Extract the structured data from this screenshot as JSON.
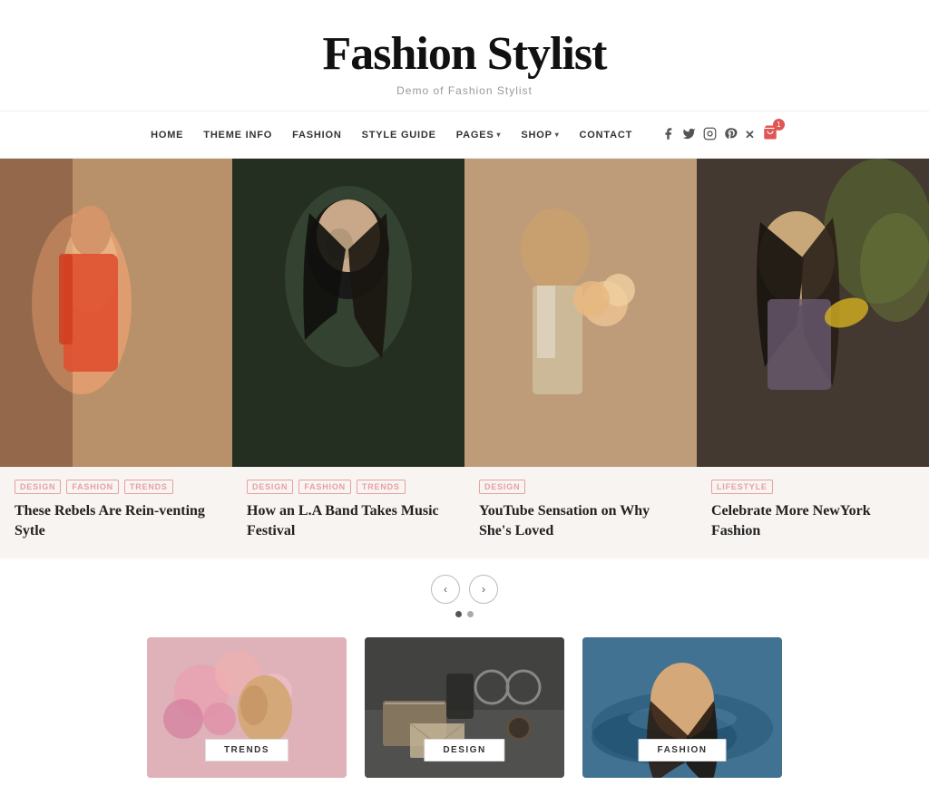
{
  "site": {
    "title": "Fashion Stylist",
    "subtitle": "Demo of Fashion Stylist"
  },
  "nav": {
    "links": [
      {
        "label": "HOME",
        "has_dropdown": false
      },
      {
        "label": "THEME INFO",
        "has_dropdown": false
      },
      {
        "label": "FASHION",
        "has_dropdown": false
      },
      {
        "label": "STYLE GUIDE",
        "has_dropdown": false
      },
      {
        "label": "PAGES",
        "has_dropdown": true
      },
      {
        "label": "SHOP",
        "has_dropdown": true
      },
      {
        "label": "CONTACT",
        "has_dropdown": false
      }
    ],
    "social": [
      "f",
      "t",
      "i",
      "p",
      "x"
    ],
    "cart_count": "1"
  },
  "hero_cards": [
    {
      "tags": [
        "DESIGN",
        "FASHION",
        "TRENDS"
      ],
      "title": "These Rebels Are Rein-venting Sytle",
      "img_color1": "#c8a090",
      "img_color2": "#8b5e4c"
    },
    {
      "tags": [
        "DESIGN",
        "FASHION",
        "TRENDS"
      ],
      "title": "How an L.A Band Takes Music Festival",
      "img_color1": "#2d3a2e",
      "img_color2": "#1a2018"
    },
    {
      "tags": [
        "DESIGN"
      ],
      "title": "YouTube Sensation on Why She's Loved",
      "img_color1": "#9e8878",
      "img_color2": "#c4a882"
    },
    {
      "tags": [
        "LIFESTYLE"
      ],
      "title": "Celebrate More NewYork Fashion",
      "img_color1": "#3a3530",
      "img_color2": "#6b5a4e"
    }
  ],
  "carousel": {
    "dots": [
      true,
      false
    ]
  },
  "bottom_cards": [
    {
      "label": "TRENDS",
      "img_color1": "#d4a0a0",
      "img_color2": "#e8c4b0"
    },
    {
      "label": "DESIGN",
      "img_color1": "#555555",
      "img_color2": "#3a3a3a"
    },
    {
      "label": "FASHION",
      "img_color1": "#4a7a9b",
      "img_color2": "#2d5a7a"
    }
  ]
}
